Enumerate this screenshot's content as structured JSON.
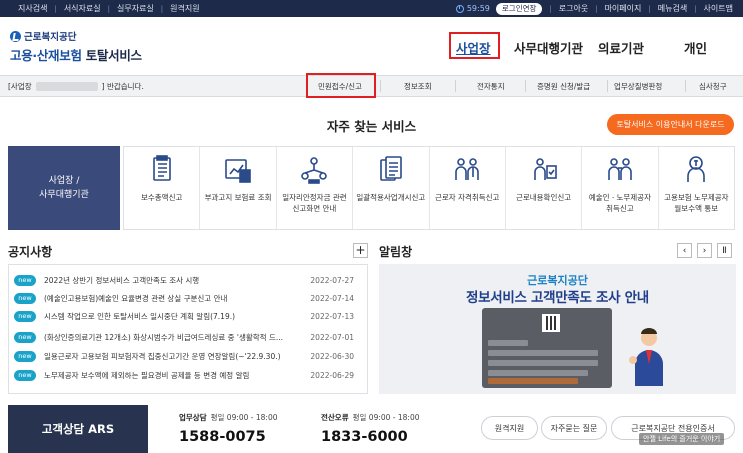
{
  "topbar": {
    "left_links": [
      "지사검색",
      "서식자료실",
      "실무자료실",
      "원격지원"
    ],
    "timer": "59:59",
    "extend_label": "로그인연장",
    "right_links": [
      "로그아웃",
      "마이페이지",
      "메뉴검색",
      "사이트맵"
    ]
  },
  "logo": {
    "org": "근로복지공단",
    "service_blue": "고용·산재보험",
    "service_dark": "토탈서비스"
  },
  "mainnav": {
    "items": [
      "사업장",
      "사무대행기관",
      "의료기관",
      "개인"
    ],
    "active_index": 0
  },
  "subbar": {
    "greet_prefix": "[사업장",
    "greet_suffix": "] 반갑습니다.",
    "tabs": [
      "민원접수/신고",
      "정보조회",
      "전자통지",
      "증명원 신청/발급",
      "업무상질병판정",
      "심사청구"
    ],
    "active_tab_index": 0
  },
  "services": {
    "title": "자주 찾는 서비스",
    "guide_button": "토탈서비스 이용안내서 다운로드",
    "side_card": [
      "사업장 /",
      "사무대행기관"
    ],
    "items": [
      {
        "label": "보수총액신고",
        "icon": "document-list-icon"
      },
      {
        "label": "부과고지 보험료 조회",
        "icon": "chart-calculator-icon"
      },
      {
        "label": "일자리안정자금 관련 신고화면 안내",
        "icon": "people-network-icon"
      },
      {
        "label": "일괄적용사업개시신고",
        "icon": "documents-stack-icon"
      },
      {
        "label": "근로자 자격취득신고",
        "icon": "worker-add-icon"
      },
      {
        "label": "근로내용확인신고",
        "icon": "worker-check-icon"
      },
      {
        "label": "예술인ㆍ노무제공자 취득신고",
        "icon": "artist-worker-icon"
      },
      {
        "label": "고용보험 노무제공자 월보수액 통보",
        "icon": "money-worker-icon"
      }
    ]
  },
  "notice": {
    "title": "공지사항",
    "more_label": "+",
    "badge": "new",
    "rows": [
      {
        "text": "2022년 상반기 정보서비스 고객만족도 조사 시행",
        "date": "2022-07-27"
      },
      {
        "text": "(예술인고용보험)예술인 요율변경 관련 상실 구분신고 안내",
        "date": "2022-07-14"
      },
      {
        "text": "시스템 작업으로 인한 토탈서비스 일시중단 계획 알림(7.19.)",
        "date": "2022-07-13"
      },
      {
        "text": "(화상인증의료기관 12개소) 화상시범수가 비급여드레싱료 중 '생활학적 드...",
        "date": "2022-07-01"
      },
      {
        "text": "일용근로자 고용보험 피보험자격 집중신고기간 운영 연장알림(~'22.9.30.)",
        "date": "2022-06-30"
      },
      {
        "text": "노무제공자 보수액에 제외하는 필요경비 공제율 등 변경 예정 알림",
        "date": "2022-06-29"
      }
    ]
  },
  "alrim": {
    "title": "알림창",
    "prev": "‹",
    "next": "›",
    "pause": "Ⅱ",
    "banner_line1": "근로복지공단",
    "banner_line2": "정보서비스 고객만족도 조사 안내"
  },
  "footer": {
    "center_label": "고객상담 ARS",
    "work_label": "업무상담",
    "work_hours": "평일 09:00 - 18:00",
    "work_phone": "1588-0075",
    "it_label": "전산오류",
    "it_hours": "평일 09:00 - 18:00",
    "it_phone": "1833-6000",
    "buttons": [
      "원격지원",
      "자주묻는 질문",
      "근로복지공단 전용인증서"
    ]
  },
  "watermark": "안젤 Life의 즐거운 이야기",
  "colors": {
    "topbar": "#1e2a4a",
    "brand_blue": "#1b4fa0",
    "accent_orange": "#f56a1f",
    "badge_teal": "#1aa3c8",
    "highlight_red": "#e02020"
  }
}
